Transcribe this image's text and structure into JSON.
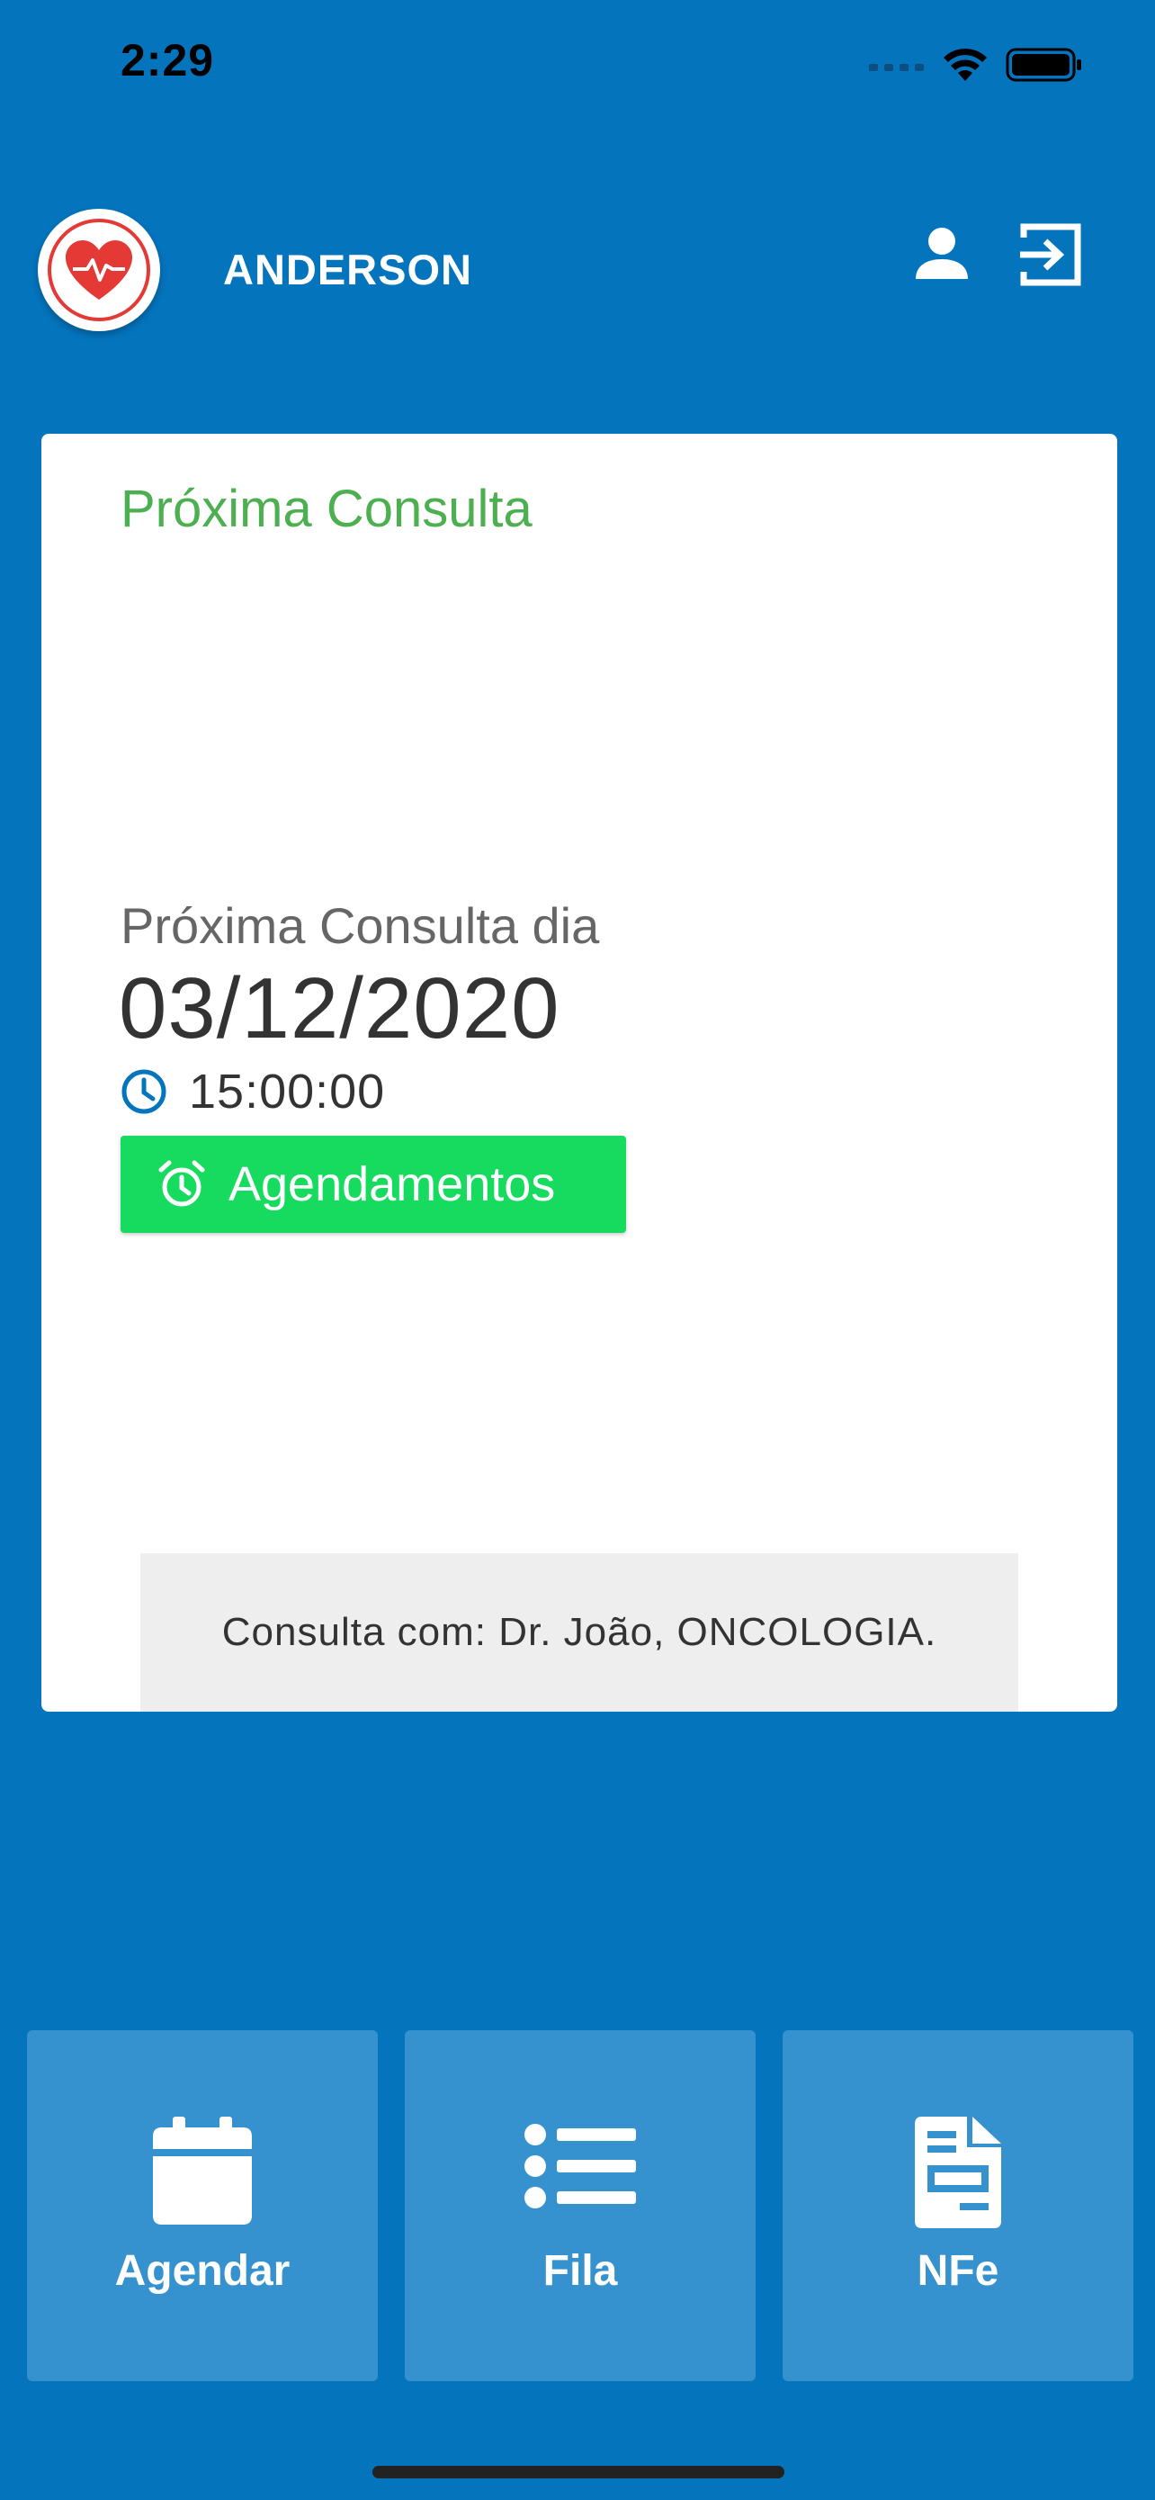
{
  "status_bar": {
    "time": "2:29"
  },
  "header": {
    "user_name": "ANDERSON",
    "logo_icon": "heart-pulse-icon",
    "profile_icon": "person-icon",
    "logout_icon": "logout-icon"
  },
  "card": {
    "title": "Próxima Consulta",
    "next_label": "Próxima Consulta dia",
    "date": "03/12/2020",
    "time": "15:00:00",
    "schedule_button": "Agendamentos",
    "doctor_info": "Consulta com: Dr. João, ONCOLOGIA."
  },
  "tiles": [
    {
      "label": "Agendar",
      "icon": "calendar-icon"
    },
    {
      "label": "Fila",
      "icon": "list-icon"
    },
    {
      "label": "NFe",
      "icon": "document-icon"
    }
  ],
  "colors": {
    "background": "#0474BD",
    "tile": "#3592CE",
    "title_green": "#4CAF50",
    "button_green": "#17DB5E",
    "logo_red": "#E53935"
  }
}
